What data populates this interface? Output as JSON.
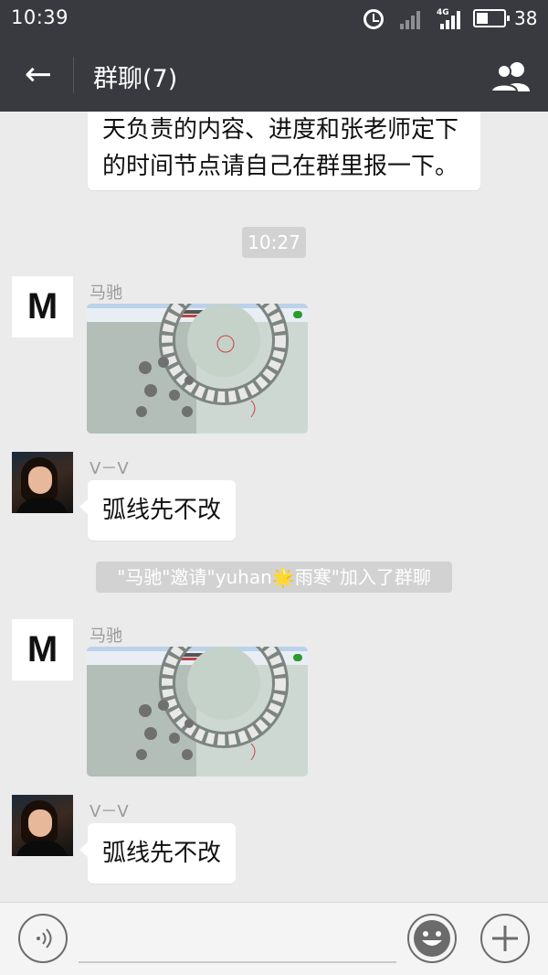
{
  "status_bar": {
    "time": "10:39",
    "network": "4G",
    "battery": "38"
  },
  "header": {
    "back_icon": "arrow-left-icon",
    "title": "群聊(7)",
    "group_icon": "group-members-icon"
  },
  "messages": {
    "partial_text": "天负责的内容、进度和张老师定下的时间节点请自己在群里报一下。",
    "timestamp": "10:27",
    "msg1_sender": "马驰",
    "msg1_avatar": "M",
    "msg2_sender": "V－V",
    "msg2_text": "弧线先不改",
    "system_msg": "\"马驰\"邀请\"yuhan🌟雨寒\"加入了群聊",
    "msg3_sender": "马驰",
    "msg3_avatar": "M",
    "msg4_sender": "V－V",
    "msg4_text": "弧线先不改"
  },
  "input_bar": {
    "voice_icon": "voice-icon",
    "emoji_icon": "emoji-icon",
    "plus_icon": "plus-icon"
  }
}
